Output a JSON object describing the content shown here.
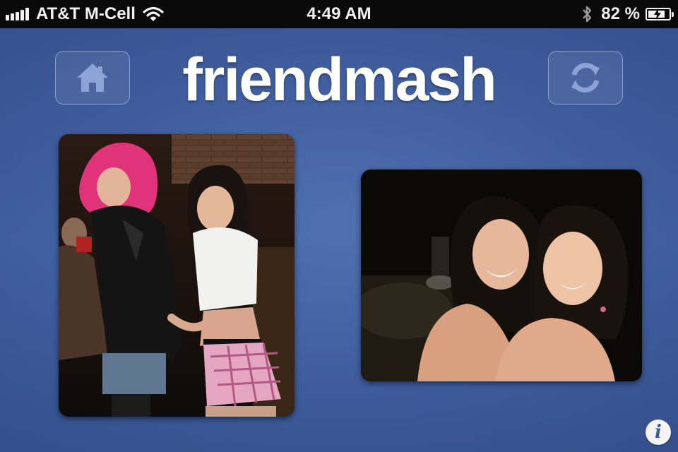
{
  "status_bar": {
    "carrier": "AT&T M-Cell",
    "time": "4:49 AM",
    "battery_percent": "82 %",
    "battery_level": 0.82,
    "signal_bars": 5,
    "icons": [
      "signal-bars-icon",
      "wifi-icon",
      "bluetooth-icon",
      "battery-charging-icon"
    ]
  },
  "app": {
    "title": "friendmash",
    "home_button": {
      "icon": "home-icon"
    },
    "refresh_button": {
      "icon": "refresh-icon"
    },
    "info_button": {
      "label": "i",
      "icon": "info-icon"
    },
    "photos": [
      {
        "position": "left",
        "description": "photo-of-two-friends-left"
      },
      {
        "position": "right",
        "description": "photo-of-two-friends-right"
      }
    ]
  },
  "colors": {
    "background": "#3d5a9c",
    "status_bar": "#0a0a0a",
    "title": "#ffffff",
    "button_border": "#becdeb"
  }
}
